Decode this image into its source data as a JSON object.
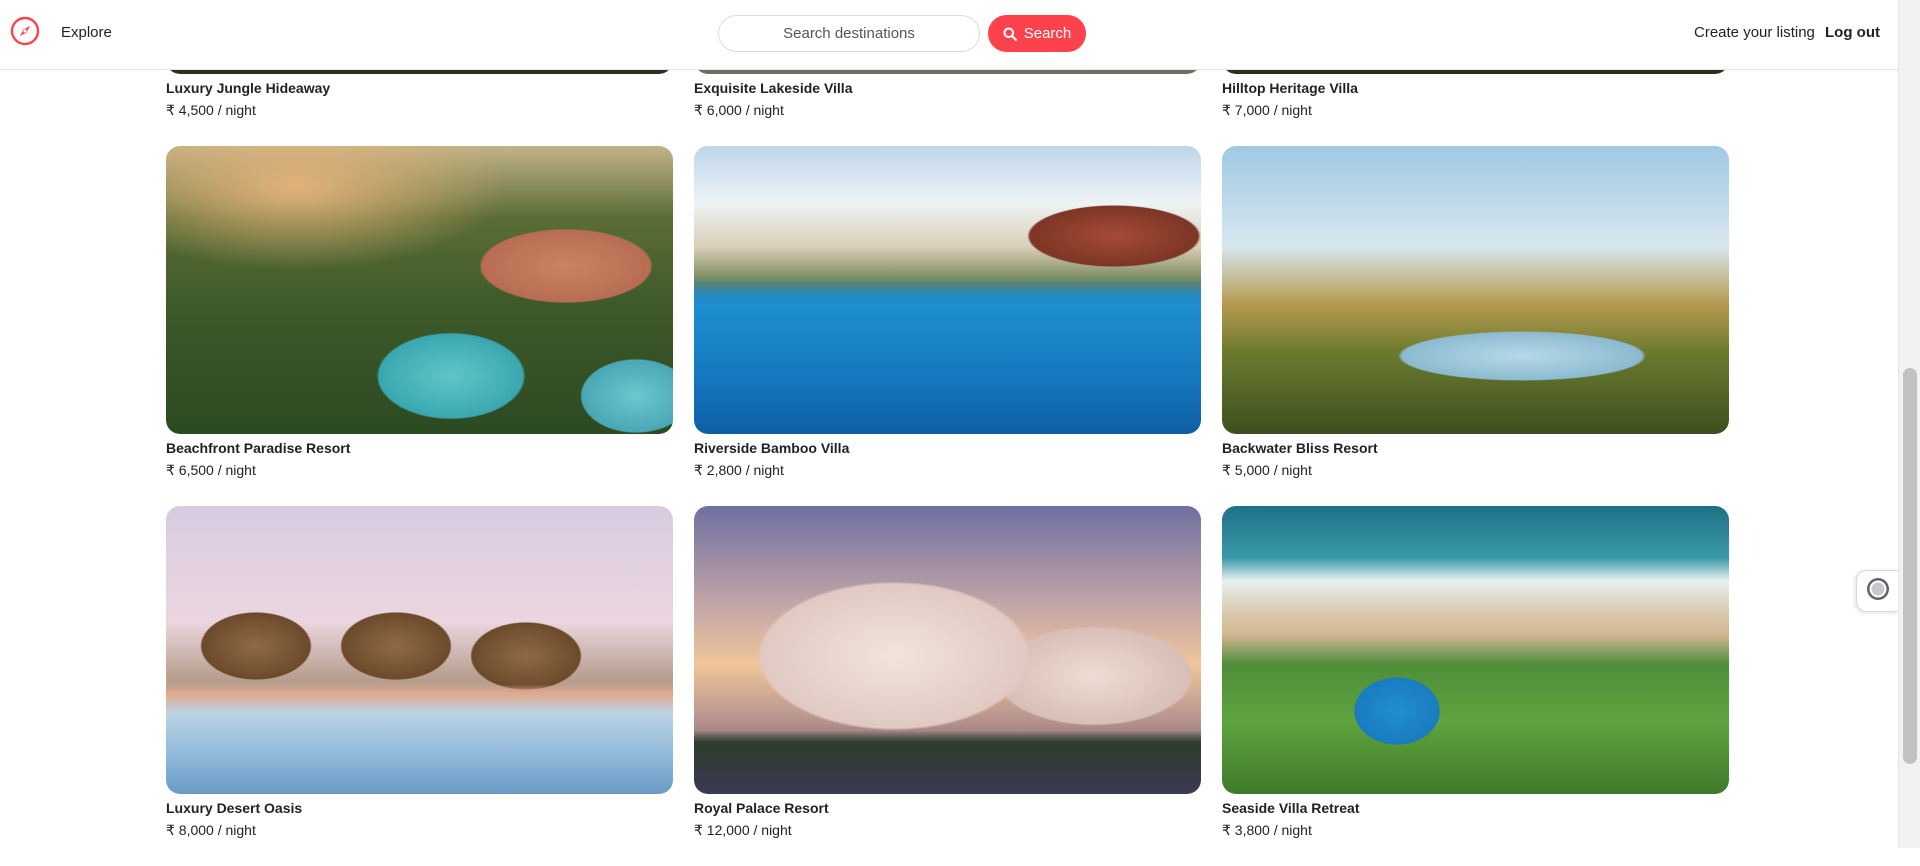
{
  "navbar": {
    "explore_label": "Explore",
    "search_placeholder": "Search destinations",
    "search_button_label": "Search",
    "create_listing_label": "Create your listing",
    "logout_label": "Log out"
  },
  "listings": [
    {
      "title": "Luxury Jungle Hideaway",
      "price": "₹ 4,500 / night"
    },
    {
      "title": "Exquisite Lakeside Villa",
      "price": "₹ 6,000 / night"
    },
    {
      "title": "Hilltop Heritage Villa",
      "price": "₹ 7,000 / night"
    },
    {
      "title": "Beachfront Paradise Resort",
      "price": "₹ 6,500 / night"
    },
    {
      "title": "Riverside Bamboo Villa",
      "price": "₹ 2,800 / night"
    },
    {
      "title": "Backwater Bliss Resort",
      "price": "₹ 5,000 / night"
    },
    {
      "title": "Luxury Desert Oasis",
      "price": "₹ 8,000 / night"
    },
    {
      "title": "Royal Palace Resort",
      "price": "₹ 12,000 / night"
    },
    {
      "title": "Seaside Villa Retreat",
      "price": "₹ 3,800 / night"
    }
  ],
  "icons": {
    "logo": "compass-icon",
    "search": "search-icon",
    "side_widget": "record-icon"
  },
  "colors": {
    "brand": "#fe424d",
    "text": "#222222",
    "border": "#e4e4e4"
  }
}
